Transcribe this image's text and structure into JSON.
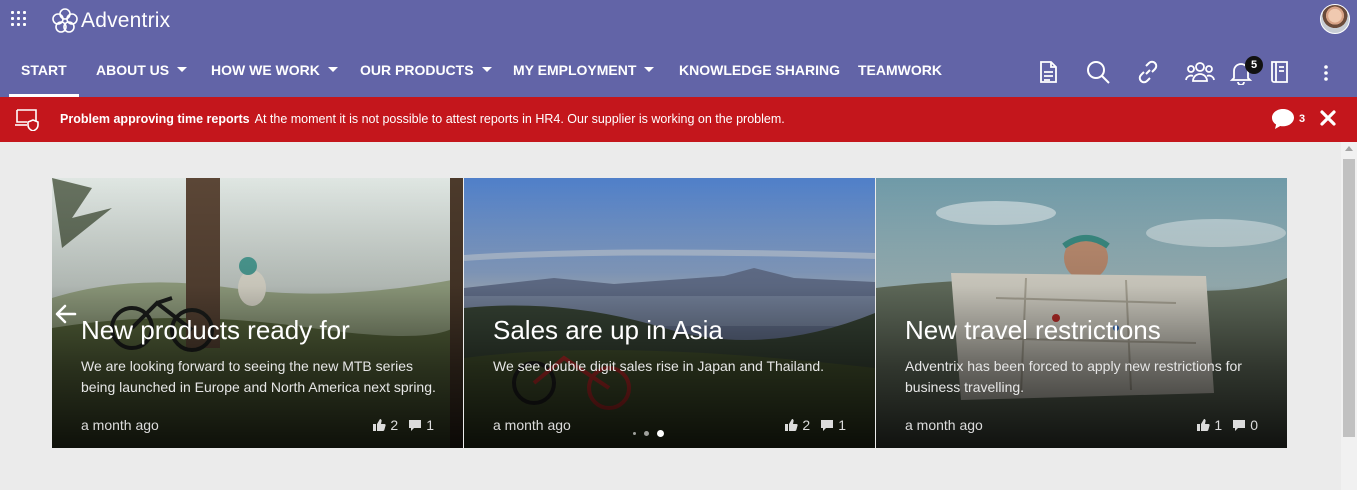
{
  "app": {
    "name": "Adventrix"
  },
  "nav": {
    "items": [
      {
        "label": "START",
        "has_dropdown": false,
        "active": true
      },
      {
        "label": "ABOUT US",
        "has_dropdown": true,
        "active": false
      },
      {
        "label": "HOW WE WORK",
        "has_dropdown": true,
        "active": false
      },
      {
        "label": "OUR PRODUCTS",
        "has_dropdown": true,
        "active": false
      },
      {
        "label": "MY EMPLOYMENT",
        "has_dropdown": true,
        "active": false
      },
      {
        "label": "KNOWLEDGE SHARING",
        "has_dropdown": false,
        "active": false
      },
      {
        "label": "TEAMWORK",
        "has_dropdown": false,
        "active": false
      }
    ],
    "icons": [
      "document-icon",
      "search-icon",
      "link-icon",
      "people-icon",
      "bell-icon",
      "book-icon",
      "more-vertical-icon"
    ],
    "notification_count": "5"
  },
  "alert": {
    "title": "Problem approving time reports",
    "message": "At the moment it is not possible to attest reports in HR4. Our supplier is working on the problem.",
    "comment_count": "3",
    "background": "#c4161c"
  },
  "carousel": {
    "cards": [
      {
        "title": "New products ready for",
        "description": "We are looking forward to seeing the new MTB series being launched in Europe and North America next spring.",
        "date": "a month ago",
        "likes": "2",
        "comments": "1"
      },
      {
        "title": "Sales are up in Asia",
        "description": "We see double digit sales rise in Japan and Thailand.",
        "date": "a month ago",
        "likes": "2",
        "comments": "1"
      },
      {
        "title": "New travel restrictions",
        "description": "Adventrix has been forced to apply new restrictions for business travelling.",
        "date": "a month ago",
        "likes": "1",
        "comments": "0"
      }
    ],
    "active_dot": 2,
    "dot_count": 3
  },
  "colors": {
    "brand": "#6264a7",
    "alert": "#c4161c",
    "page_bg": "#ebebeb"
  }
}
